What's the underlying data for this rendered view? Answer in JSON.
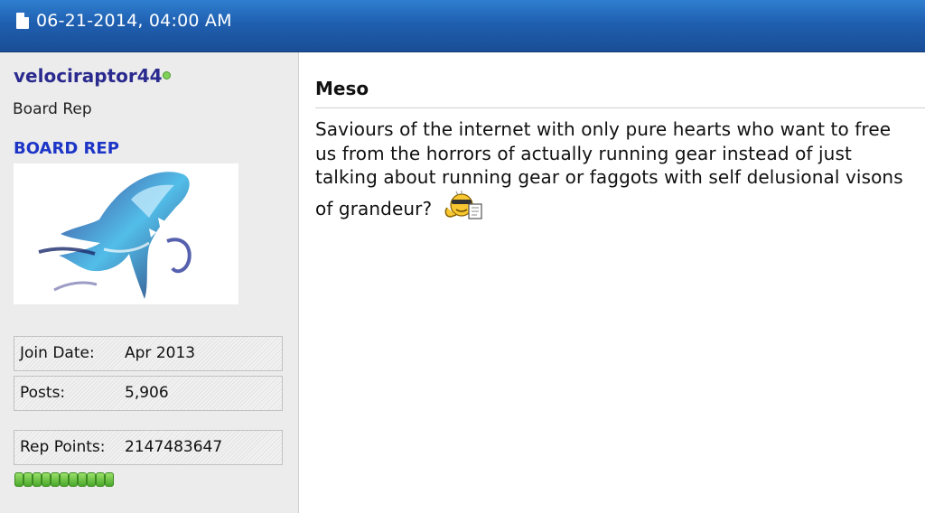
{
  "header": {
    "date": "06-21-2014, 04:00 AM",
    "icon": "document-icon"
  },
  "user": {
    "username": "velociraptor44",
    "status_icon": "online-status-icon",
    "title": "Board Rep",
    "rank": "BOARD REP",
    "avatar": "raptor-avatar",
    "stats": [
      {
        "label": "Join Date:",
        "value": "Apr 2013"
      },
      {
        "label": "Posts:",
        "value": "5,906"
      },
      {
        "label": "Rep Points:",
        "value": "2147483647"
      }
    ],
    "rep_pips": 11
  },
  "post": {
    "title": "Meso",
    "body": "Saviours of the internet with only pure hearts who want to free us from the horrors of actually running gear instead of just talking about running gear or faggots with self delusional visons of grandeur?",
    "smiley": "thinking-smiley-icon"
  },
  "colors": {
    "header_top": "#2f7fd0",
    "header_bottom": "#1a4e96",
    "username": "#2b2b8f",
    "rank": "#1d35c7",
    "rep_green": "#4aa82a",
    "sidebar_bg": "#ececec"
  }
}
